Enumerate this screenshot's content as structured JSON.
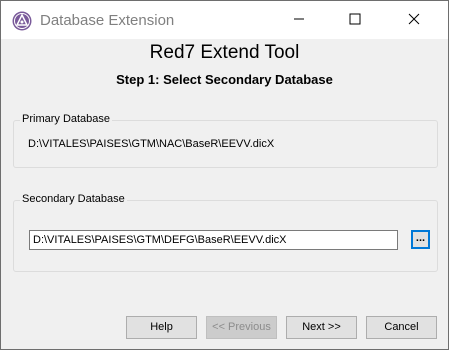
{
  "window": {
    "title": "Database Extension",
    "app_icon": "purple-triangle-icon",
    "controls": {
      "minimize": "minimize-icon",
      "maximize": "maximize-icon",
      "close": "close-icon"
    }
  },
  "header": {
    "title": "Red7 Extend Tool",
    "step": "Step 1: Select Secondary Database"
  },
  "primary": {
    "label": "Primary Database",
    "path": "D:\\VITALES\\PAISES\\GTM\\NAC\\BaseR\\EEVV.dicX"
  },
  "secondary": {
    "label": "Secondary Database",
    "path": "D:\\VITALES\\PAISES\\GTM\\DEFG\\BaseR\\EEVV.dicX",
    "browse_label": "..."
  },
  "buttons": {
    "help": "Help",
    "previous": "<< Previous",
    "next": "Next >>",
    "cancel": "Cancel"
  },
  "colors": {
    "focus": "#0078d7",
    "icon_purple": "#7a5a9a"
  }
}
